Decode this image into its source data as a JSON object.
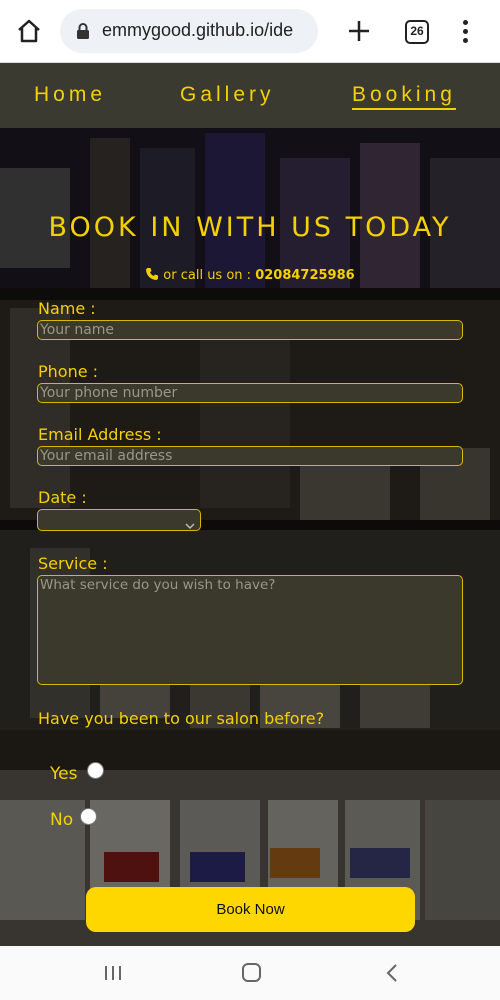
{
  "browser": {
    "url": "emmygood.github.io/ide",
    "tab_count": "26"
  },
  "nav": {
    "items": [
      {
        "label": "Home"
      },
      {
        "label": "Gallery"
      },
      {
        "label": "Booking"
      }
    ],
    "active": "Booking"
  },
  "form": {
    "title": "BOOK IN WITH US TODAY",
    "call_prefix": "or call us on :",
    "call_number": "02084725986",
    "name_label": "Name :",
    "name_placeholder": "Your name",
    "phone_label": "Phone :",
    "phone_placeholder": "Your phone number",
    "email_label": "Email Address :",
    "email_placeholder": "Your email address",
    "date_label": "Date :",
    "service_label": "Service :",
    "service_placeholder": "What service do you wish to have?",
    "question": "Have you been to our salon before?",
    "option_yes": "Yes",
    "option_no": "No",
    "submit_label": "Book Now"
  },
  "colors": {
    "accent": "#f5d000",
    "nav_bg": "#3a3a30",
    "button": "#ffd700"
  }
}
